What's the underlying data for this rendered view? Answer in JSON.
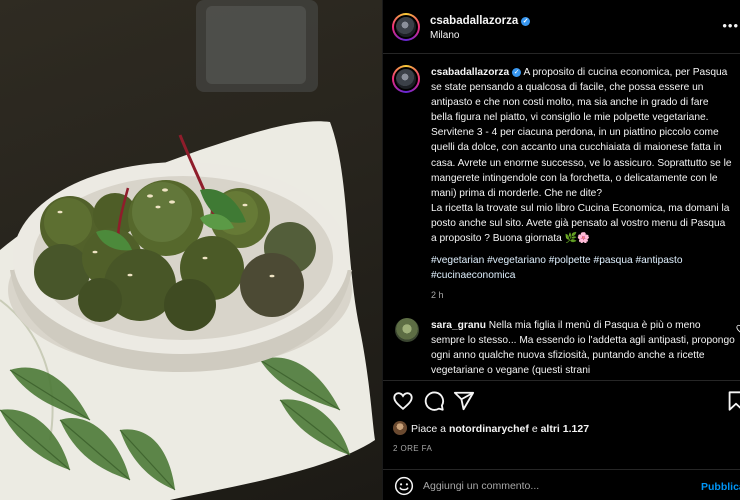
{
  "colors": {
    "accent": "#0095f6",
    "verified": "#3897f0",
    "hashtag": "#e0f1ff",
    "muted": "#a8a8a8"
  },
  "photo": {
    "description_icon": "food-photo"
  },
  "header": {
    "username": "csabadallazorza",
    "location": "Milano",
    "more_icon": "more-icon"
  },
  "caption": {
    "username": "csabadallazorza",
    "text": "A proposito di cucina economica, per Pasqua se state pensando a qualcosa di facile, che possa essere un antipasto e che non costi molto, ma sia anche in grado di fare bella figura nel piatto, vi consiglio le mie polpette vegetariane. Servitene 3 - 4 per ciacuna perdona, in un piattino piccolo come quelli da dolce, con accanto una cucchiaiata di maionese fatta in casa. Avrete un enorme successo, ve lo assicuro. Soprattutto se le mangerete intingendole con la forchetta, o delicatamente con le mani) prima di morderle. Che ne dite?",
    "text2": "La ricetta la trovate sul mio libro Cucina Economica, ma domani la posto anche sul sito. Avete già pensato al vostro menu di Pasqua a proposito ? Buona giornata 🌿🌸",
    "hashtags": "#vegetarian #vegetariano #polpette #pasqua #antipasto #cucinaeconomica",
    "time": "2 h"
  },
  "comment": {
    "username": "sara_granu",
    "text": "Nella mia figlia il menù di Pasqua è più o meno sempre lo stesso... Ma essendo io l'addetta agli antipasti, propongo ogni anno qualche nuova sfiziosità, puntando anche a ricette vegetariane o vegane (questi strani"
  },
  "actions": {
    "icons": [
      "heart-icon",
      "comment-icon",
      "share-icon",
      "bookmark-icon"
    ],
    "liked_by_prefix": "Piace a",
    "liked_by_user": "notordinarychef",
    "liked_by_suffix": "e",
    "others": "altri 1.127",
    "post_time": "2 ORE FA"
  },
  "add_comment": {
    "placeholder": "Aggiungi un commento...",
    "publish_label": "Pubblica"
  }
}
